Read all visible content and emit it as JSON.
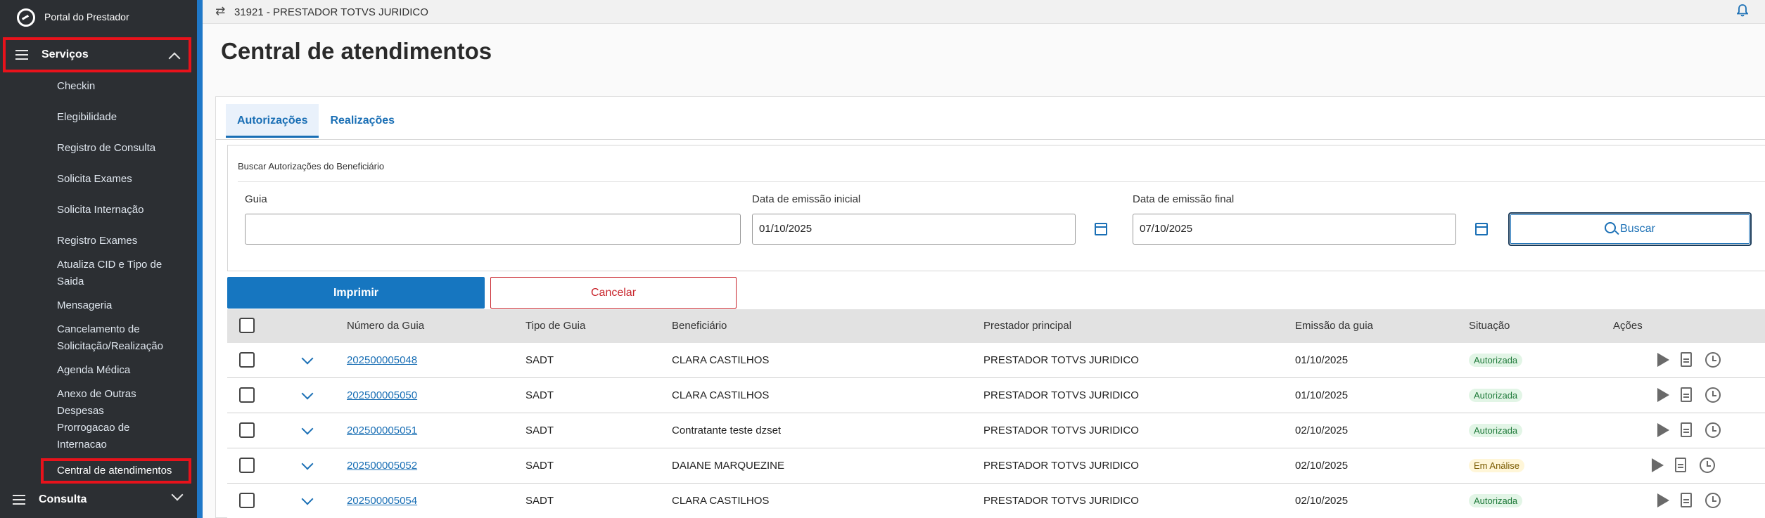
{
  "sidebar": {
    "brand": "Portal do Prestador",
    "section_servicos": "Serviços",
    "items": [
      {
        "label": "Checkin"
      },
      {
        "label": "Elegibilidade"
      },
      {
        "label": "Registro de Consulta"
      },
      {
        "label": "Solicita Exames"
      },
      {
        "label": "Solicita Internação"
      },
      {
        "label": "Registro Exames"
      },
      {
        "label": "Atualiza CID e Tipo de Saida"
      },
      {
        "label": "Mensageria"
      },
      {
        "label": "Cancelamento de Solicitação/Realização"
      },
      {
        "label": "Agenda Médica"
      },
      {
        "label": "Anexo de Outras Despesas"
      },
      {
        "label": "Prorrogacao de Internacao"
      },
      {
        "label": "Central de atendimentos"
      }
    ],
    "section_consulta": "Consulta"
  },
  "topbar": {
    "title": "31921 - PRESTADOR TOTVS JURIDICO"
  },
  "page": {
    "title": "Central de atendimentos"
  },
  "tabs": [
    {
      "label": "Autorizações"
    },
    {
      "label": "Realizações"
    }
  ],
  "search": {
    "title": "Buscar Autorizações do Beneficiário",
    "guia_label": "Guia",
    "guia_value": "",
    "data_inicial_label": "Data de emissão inicial",
    "data_inicial_value": "01/10/2025",
    "data_final_label": "Data de emissão final",
    "data_final_value": "07/10/2025",
    "buscar_label": "Buscar"
  },
  "actions": {
    "imprimir": "Imprimir",
    "cancelar": "Cancelar"
  },
  "table": {
    "headers": {
      "numero": "Número da Guia",
      "tipo": "Tipo de Guia",
      "beneficiario": "Beneficiário",
      "prestador": "Prestador principal",
      "emissao": "Emissão da guia",
      "situacao": "Situação",
      "acoes": "Ações"
    },
    "rows": [
      {
        "numero": "202500005048",
        "tipo": "SADT",
        "beneficiario": "CLARA CASTILHOS",
        "prestador": "PRESTADOR TOTVS JURIDICO",
        "emissao": "01/10/2025",
        "situacao": "Autorizada"
      },
      {
        "numero": "202500005050",
        "tipo": "SADT",
        "beneficiario": "CLARA CASTILHOS",
        "prestador": "PRESTADOR TOTVS JURIDICO",
        "emissao": "01/10/2025",
        "situacao": "Autorizada"
      },
      {
        "numero": "202500005051",
        "tipo": "SADT",
        "beneficiario": "Contratante teste dzset",
        "prestador": "PRESTADOR TOTVS JURIDICO",
        "emissao": "02/10/2025",
        "situacao": "Autorizada"
      },
      {
        "numero": "202500005052",
        "tipo": "SADT",
        "beneficiario": "DAIANE MARQUEZINE",
        "prestador": "PRESTADOR TOTVS JURIDICO",
        "emissao": "02/10/2025",
        "situacao": "Em Análise"
      },
      {
        "numero": "202500005054",
        "tipo": "SADT",
        "beneficiario": "CLARA CASTILHOS",
        "prestador": "PRESTADOR TOTVS JURIDICO",
        "emissao": "02/10/2025",
        "situacao": "Autorizada"
      }
    ]
  }
}
